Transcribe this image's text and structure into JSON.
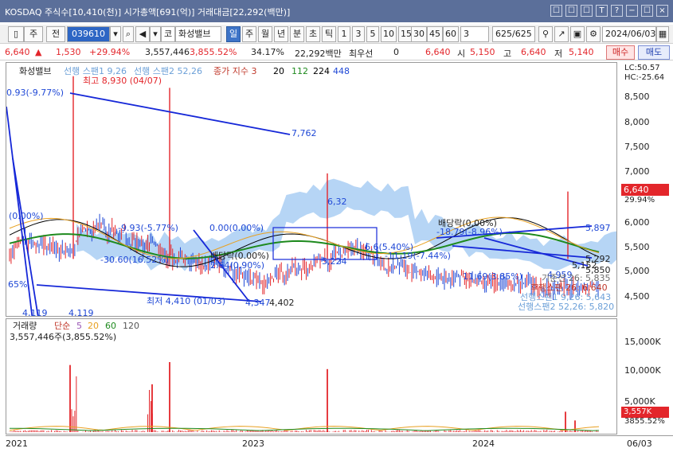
{
  "window": {
    "title": "KOSDAQ 주식수[10,410(천)] 시가총액[691(억)] 거래대금[22,292(백만)]",
    "controls": [
      "☐",
      "☐",
      "☐",
      "T",
      "?",
      "−",
      "☐",
      "×"
    ]
  },
  "toolbar": {
    "market_sel": "주",
    "market_sel2": "전",
    "code": "039610",
    "name_prefix": "코",
    "name": "화성밸브",
    "periods": [
      "일",
      "주",
      "월",
      "년",
      "분",
      "초",
      "틱"
    ],
    "active_period": "일",
    "intervals": [
      "1",
      "3",
      "5",
      "10",
      "15",
      "30",
      "45",
      "60"
    ],
    "interval_select": "3",
    "counter": "625/625",
    "date": "2024/06/03"
  },
  "quote": {
    "price": "6,640",
    "change": "1,530",
    "change_pct": "+29.94%",
    "volume": "3,557,446",
    "volume_pct": "3,855.52%",
    "turnover": "34.17%",
    "amount": "22,292백만",
    "extra_label": "최우선",
    "extra_val": "0",
    "best": "6,640",
    "open_label": "시",
    "open": "5,150",
    "high_label": "고",
    "high": "6,640",
    "low_label": "저",
    "low": "5,140",
    "buy": "매수",
    "sell": "매도"
  },
  "price_panel": {
    "name": "화성밸브",
    "legend": [
      "선행 스팬1 9,26",
      "선행 스팬2 52,26",
      "종가 지수 3",
      "20",
      "112",
      "224",
      "448"
    ],
    "lc": "LC:50.57",
    "hc": "HC:-25.64",
    "labels": {
      "max": "최고 8,930 (04/07)",
      "min": "최저 4,410 (01/03)",
      "pct_left": "0.93(-9.77%)",
      "zero": "(0.00%)",
      "neg": "-9.93(-5.77%)",
      "b1": "-30.60(16.52%)",
      "b2": "0.00(0.00%)",
      "b3": "배당락(0.00%)",
      "b4": "2.64(0.90%)",
      "b5": "65%",
      "mid1": "5,224",
      "mid2": "6,32",
      "mid3": "6.6(5.40%)",
      "mid4": "-11.19(-7.44%)",
      "div": "배당락(0.00%)",
      "div2": "-18.79(-8.96%)",
      "r1": "11.69(3.85%)",
      "r2": "4,959",
      "r3": "5,152",
      "line1": "7,762",
      "line2": "5,897",
      "line3": "5,292",
      "low1": "4,347",
      "low2": "4,402",
      "low3": "4,119",
      "low4": "4,119"
    },
    "right_info": [
      {
        "label": "기준선 26: 5,835"
      },
      {
        "label": "후행스팬 26: 6,640"
      },
      {
        "label": "선행스팬1 9,26: 5,643"
      },
      {
        "label": "선행스팬2 52,26: 5,820"
      }
    ],
    "current_price_tag": "6,640",
    "current_pct_tag": "29.94%",
    "ticks": [
      "8,500",
      "8,000",
      "7,500",
      "7,000",
      "6,500",
      "6,000",
      "5,500",
      "5,000",
      "4,500"
    ],
    "small_tag": "5,850"
  },
  "volume_panel": {
    "legend": [
      "거래량",
      "단순",
      "5",
      "20",
      "60",
      "120"
    ],
    "value": "3,557,446주(3,855.52%)",
    "ticks": [
      "15,000K",
      "10,000K",
      "5,000K"
    ],
    "current_tag": "3,557K",
    "current_pct": "3855.52%"
  },
  "xaxis": {
    "labels": [
      "2021",
      "2023",
      "2024",
      "06/03"
    ]
  },
  "colors": {
    "title_bg": "#5b6f9a",
    "up": "#e3262b",
    "down": "#1f48d6",
    "cloud": "#9dc7f1",
    "ma20": "#000000",
    "ma112": "#1e8a1e"
  }
}
